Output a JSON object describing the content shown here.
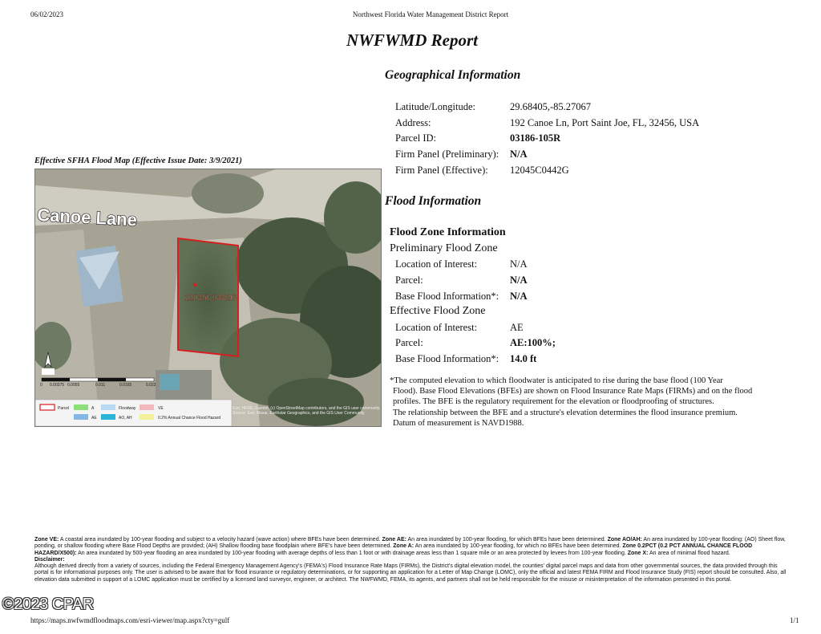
{
  "header": {
    "date": "06/02/2023",
    "doc_title": "Northwest Florida Water Management District Report"
  },
  "title": "NWFWMD Report",
  "geo": {
    "heading": "Geographical Information",
    "rows": [
      {
        "label": "Latitude/Longitude:",
        "value": "29.68405,-85.27067"
      },
      {
        "label": "Address:",
        "value": "192 Canoe Ln, Port Saint Joe, FL, 32456, USA"
      },
      {
        "label": "Parcel ID:",
        "value": "03186-105R"
      },
      {
        "label": "Firm Panel (Preliminary):",
        "value": "N/A"
      },
      {
        "label": "Firm Panel (Effective):",
        "value": "12045C0442G"
      }
    ]
  },
  "flood": {
    "heading": "Flood Information",
    "zone_heading": "Flood Zone Information",
    "preliminary": {
      "heading": "Preliminary Flood Zone",
      "rows": [
        {
          "label": "Location of Interest:",
          "value": "N/A"
        },
        {
          "label": "Parcel:",
          "value": "N/A"
        },
        {
          "label": "Base Flood Information*:",
          "value": "N/A"
        }
      ]
    },
    "effective": {
      "heading": "Effective Flood Zone",
      "rows": [
        {
          "label": "Location of Interest:",
          "value": "AE"
        },
        {
          "label": "Parcel:",
          "value": "AE:100%;"
        },
        {
          "label": "Base Flood Information*:",
          "value": "14.0 ft"
        }
      ]
    },
    "note_lines": [
      "*The computed elevation to which floodwater is anticipated to rise during the base flood (100 Year",
      "Flood). Base Flood Elevations (BFEs) are shown on Flood Insurance Rate Maps (FIRMs) and on the flood",
      "profiles. The BFE is the regulatory requirement for the elevation or floodproofing of structures.",
      "The relationship between the BFE and a structure's elevation determines the flood insurance premium.",
      "Datum of measurement is NAVD1988."
    ]
  },
  "map": {
    "title": "Effective SFHA Flood Map (Effective Issue Date: 3/9/2021)",
    "street_label": "Canoe Lane",
    "panel_label": "12045C0442G",
    "scale_labels": [
      "0",
      "0.00275",
      "0.0055",
      "0.011",
      "0.0165",
      "0.022"
    ],
    "attribution": "Esri, HERE, Garmin, (c) OpenStreetMap contributors, and the GIS user community. Source: Esri, Maxar, Earthstar Geographics, and the GIS User Community",
    "legend": [
      {
        "label": "Parcel",
        "color": "#ffffff",
        "stroke": "#d81e1e"
      },
      {
        "label": "A",
        "color": "#8be07a"
      },
      {
        "label": "Floodway",
        "color": "#b9d9f3"
      },
      {
        "label": "VE",
        "color": "#f3b7bd"
      },
      {
        "label": "AE",
        "color": "#85b7e6"
      },
      {
        "label": "AO, AH",
        "color": "#29b4d8"
      },
      {
        "label": "0.2% Annual Chance Flood Hazard",
        "color": "#f5f09a"
      }
    ]
  },
  "footer": {
    "definitions": [
      {
        "term": "Zone VE:",
        "text": " A coastal area inundated by 100-year flooding and subject to a velocity hazard (wave action) where BFEs have been determined. "
      },
      {
        "term": "Zone AE:",
        "text": " An area inundated by 100-year flooding, for which BFEs have been determined. "
      },
      {
        "term": "Zone AO/AH:",
        "text": " An area inundated by 100-year flooding: (AO) Sheet flow, ponding, or shallow flooding where Base Flood Depths are provided; (AH) Shallow flooding base floodplain where BFE's have been determined. "
      },
      {
        "term": "Zone A:",
        "text": " An area inundated by 100-year flooding, for which no BFEs have been determined. "
      },
      {
        "term": "Zone 0.2PCT (0.2 PCT ANNUAL CHANCE FLOOD HAZARD/X500):",
        "text": " An area inundated by 500-year flooding an area inundated by 100-year flooding with average depths of less than 1 foot or with drainage areas less than 1 square mile or an area protected by levees from 100-year flooding. "
      },
      {
        "term": "Zone X:",
        "text": " An area of minimal flood hazard."
      }
    ],
    "disclaimer_heading": "Disclaimer:",
    "disclaimer": "Although derived directly from a variety of sources, including the Federal Emergency Management Agency's (FEMA's) Flood Insurance Rate Maps (FIRMs), the District's digital elevation model, the counties' digital parcel maps and data from other governmental sources, the data provided through this portal is for informational purposes only. The user is advised to be aware that for flood insurance or regulatory determinations, or for supporting an application for a Letter of Map Change (LOMC), only the official and latest FEMA FIRM and Flood Insurance Study (FIS) report should be consulted. Also, all elevation data submitted in support of a LOMC application must be certified by a licensed land surveyor, engineer, or architect. The NWFWMD, FEMA, its agents, and partners shall not be held responsible for the misuse or misinterpretation of the information presented in this portal.",
    "url": "https://maps.nwfwmdfloodmaps.com/esri-viewer/map.aspx?cty=gulf",
    "page": "1/1"
  },
  "watermark": "©2023 CPAR"
}
